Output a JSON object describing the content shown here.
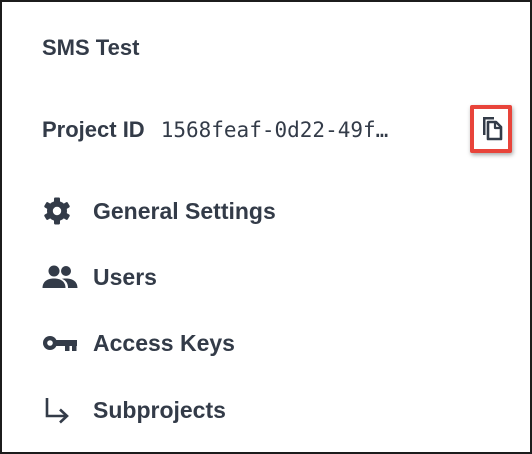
{
  "project": {
    "name": "SMS Test",
    "id_label": "Project ID",
    "id_value": "1568feaf-0d22-49f…"
  },
  "copy_button": {
    "icon": "copy-icon",
    "highlight_color": "#e8443a"
  },
  "menu": {
    "items": [
      {
        "label": "General Settings",
        "icon": "gear-icon"
      },
      {
        "label": "Users",
        "icon": "users-icon"
      },
      {
        "label": "Access Keys",
        "icon": "key-icon"
      },
      {
        "label": "Subprojects",
        "icon": "subdirectory-arrow-icon"
      }
    ]
  },
  "colors": {
    "text": "#333b48",
    "highlight": "#e8443a"
  }
}
